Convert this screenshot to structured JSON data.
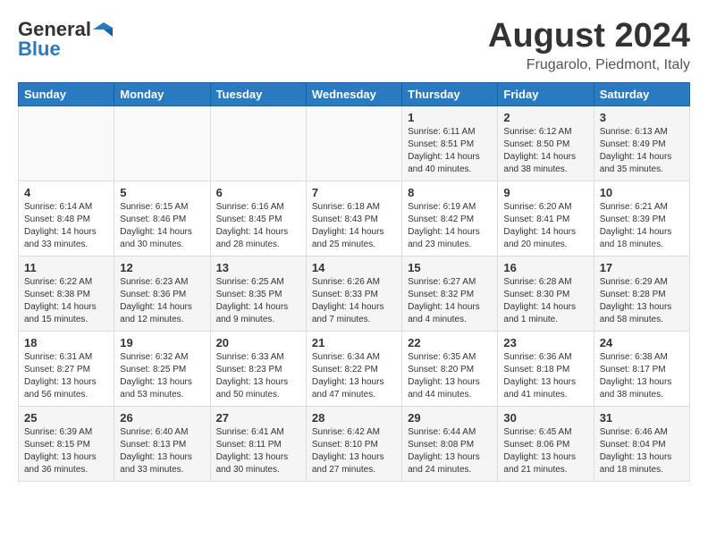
{
  "header": {
    "logo_line1": "General",
    "logo_line2": "Blue",
    "month_year": "August 2024",
    "location": "Frugarolo, Piedmont, Italy"
  },
  "days_of_week": [
    "Sunday",
    "Monday",
    "Tuesday",
    "Wednesday",
    "Thursday",
    "Friday",
    "Saturday"
  ],
  "weeks": [
    [
      {
        "day": "",
        "info": ""
      },
      {
        "day": "",
        "info": ""
      },
      {
        "day": "",
        "info": ""
      },
      {
        "day": "",
        "info": ""
      },
      {
        "day": "1",
        "info": "Sunrise: 6:11 AM\nSunset: 8:51 PM\nDaylight: 14 hours\nand 40 minutes."
      },
      {
        "day": "2",
        "info": "Sunrise: 6:12 AM\nSunset: 8:50 PM\nDaylight: 14 hours\nand 38 minutes."
      },
      {
        "day": "3",
        "info": "Sunrise: 6:13 AM\nSunset: 8:49 PM\nDaylight: 14 hours\nand 35 minutes."
      }
    ],
    [
      {
        "day": "4",
        "info": "Sunrise: 6:14 AM\nSunset: 8:48 PM\nDaylight: 14 hours\nand 33 minutes."
      },
      {
        "day": "5",
        "info": "Sunrise: 6:15 AM\nSunset: 8:46 PM\nDaylight: 14 hours\nand 30 minutes."
      },
      {
        "day": "6",
        "info": "Sunrise: 6:16 AM\nSunset: 8:45 PM\nDaylight: 14 hours\nand 28 minutes."
      },
      {
        "day": "7",
        "info": "Sunrise: 6:18 AM\nSunset: 8:43 PM\nDaylight: 14 hours\nand 25 minutes."
      },
      {
        "day": "8",
        "info": "Sunrise: 6:19 AM\nSunset: 8:42 PM\nDaylight: 14 hours\nand 23 minutes."
      },
      {
        "day": "9",
        "info": "Sunrise: 6:20 AM\nSunset: 8:41 PM\nDaylight: 14 hours\nand 20 minutes."
      },
      {
        "day": "10",
        "info": "Sunrise: 6:21 AM\nSunset: 8:39 PM\nDaylight: 14 hours\nand 18 minutes."
      }
    ],
    [
      {
        "day": "11",
        "info": "Sunrise: 6:22 AM\nSunset: 8:38 PM\nDaylight: 14 hours\nand 15 minutes."
      },
      {
        "day": "12",
        "info": "Sunrise: 6:23 AM\nSunset: 8:36 PM\nDaylight: 14 hours\nand 12 minutes."
      },
      {
        "day": "13",
        "info": "Sunrise: 6:25 AM\nSunset: 8:35 PM\nDaylight: 14 hours\nand 9 minutes."
      },
      {
        "day": "14",
        "info": "Sunrise: 6:26 AM\nSunset: 8:33 PM\nDaylight: 14 hours\nand 7 minutes."
      },
      {
        "day": "15",
        "info": "Sunrise: 6:27 AM\nSunset: 8:32 PM\nDaylight: 14 hours\nand 4 minutes."
      },
      {
        "day": "16",
        "info": "Sunrise: 6:28 AM\nSunset: 8:30 PM\nDaylight: 14 hours\nand 1 minute."
      },
      {
        "day": "17",
        "info": "Sunrise: 6:29 AM\nSunset: 8:28 PM\nDaylight: 13 hours\nand 58 minutes."
      }
    ],
    [
      {
        "day": "18",
        "info": "Sunrise: 6:31 AM\nSunset: 8:27 PM\nDaylight: 13 hours\nand 56 minutes."
      },
      {
        "day": "19",
        "info": "Sunrise: 6:32 AM\nSunset: 8:25 PM\nDaylight: 13 hours\nand 53 minutes."
      },
      {
        "day": "20",
        "info": "Sunrise: 6:33 AM\nSunset: 8:23 PM\nDaylight: 13 hours\nand 50 minutes."
      },
      {
        "day": "21",
        "info": "Sunrise: 6:34 AM\nSunset: 8:22 PM\nDaylight: 13 hours\nand 47 minutes."
      },
      {
        "day": "22",
        "info": "Sunrise: 6:35 AM\nSunset: 8:20 PM\nDaylight: 13 hours\nand 44 minutes."
      },
      {
        "day": "23",
        "info": "Sunrise: 6:36 AM\nSunset: 8:18 PM\nDaylight: 13 hours\nand 41 minutes."
      },
      {
        "day": "24",
        "info": "Sunrise: 6:38 AM\nSunset: 8:17 PM\nDaylight: 13 hours\nand 38 minutes."
      }
    ],
    [
      {
        "day": "25",
        "info": "Sunrise: 6:39 AM\nSunset: 8:15 PM\nDaylight: 13 hours\nand 36 minutes."
      },
      {
        "day": "26",
        "info": "Sunrise: 6:40 AM\nSunset: 8:13 PM\nDaylight: 13 hours\nand 33 minutes."
      },
      {
        "day": "27",
        "info": "Sunrise: 6:41 AM\nSunset: 8:11 PM\nDaylight: 13 hours\nand 30 minutes."
      },
      {
        "day": "28",
        "info": "Sunrise: 6:42 AM\nSunset: 8:10 PM\nDaylight: 13 hours\nand 27 minutes."
      },
      {
        "day": "29",
        "info": "Sunrise: 6:44 AM\nSunset: 8:08 PM\nDaylight: 13 hours\nand 24 minutes."
      },
      {
        "day": "30",
        "info": "Sunrise: 6:45 AM\nSunset: 8:06 PM\nDaylight: 13 hours\nand 21 minutes."
      },
      {
        "day": "31",
        "info": "Sunrise: 6:46 AM\nSunset: 8:04 PM\nDaylight: 13 hours\nand 18 minutes."
      }
    ]
  ]
}
